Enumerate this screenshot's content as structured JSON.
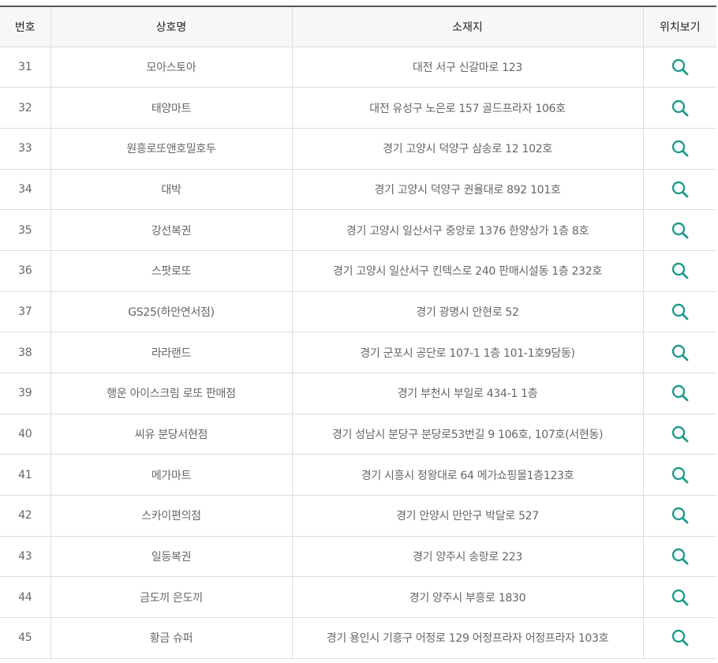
{
  "table": {
    "headers": [
      "번호",
      "상호명",
      "소재지",
      "위치보기"
    ],
    "rows": [
      {
        "no": "31",
        "name": "모아스토아",
        "address": "대전 서구 신갈마로 123",
        "icon": "search-icon"
      },
      {
        "no": "32",
        "name": "태양마트",
        "address": "대전 유성구 노은로 157 골드프라자 106호",
        "icon": "search-icon"
      },
      {
        "no": "33",
        "name": "원흥로또앤호밀호두",
        "address": "경기 고양시 덕양구 삼송로 12 102호",
        "icon": "search-icon"
      },
      {
        "no": "34",
        "name": "대박",
        "address": "경기 고양시 덕양구 권율대로 892 101호",
        "icon": "search-icon"
      },
      {
        "no": "35",
        "name": "강선복권",
        "address": "경기 고양시 일산서구 중앙로 1376 한양상가 1층 8호",
        "icon": "search-icon"
      },
      {
        "no": "36",
        "name": "스팟로또",
        "address": "경기 고양시 일산서구 킨텍스로 240 판매시설동 1층 232호",
        "icon": "search-icon"
      },
      {
        "no": "37",
        "name": "GS25(하안연서점)",
        "address": "경기 광명시 안현로 52",
        "icon": "search-icon"
      },
      {
        "no": "38",
        "name": "라라랜드",
        "address": "경기 군포시 공단로 107-1 1층 101-1호9당동)",
        "icon": "search-icon"
      },
      {
        "no": "39",
        "name": "행운 아이스크림 로또 판매점",
        "address": "경기 부천시 부일로 434-1 1층",
        "icon": "search-icon"
      },
      {
        "no": "40",
        "name": "씨유 분당서현점",
        "address": "경기 성남시 분당구 분당로53번길 9 106호, 107호(서현동)",
        "icon": "search-icon"
      },
      {
        "no": "41",
        "name": "메가마트",
        "address": "경기 시흥시 정왕대로 64 메가쇼핑몰1층123호",
        "icon": "search-icon"
      },
      {
        "no": "42",
        "name": "스카이편의점",
        "address": "경기 안양시 만안구 박달로 527",
        "icon": "search-icon"
      },
      {
        "no": "43",
        "name": "일등복권",
        "address": "경기 양주시 송랑로 223",
        "icon": "search-icon"
      },
      {
        "no": "44",
        "name": "금도끼 은도끼",
        "address": "경기 양주시 부흥로 1830",
        "icon": "search-icon"
      },
      {
        "no": "45",
        "name": "황금 슈퍼",
        "address": "경기 용인시 기흥구 어정로 129 어정프라자 어정프라자 103호",
        "icon": "search-icon"
      }
    ]
  },
  "colors": {
    "icon": "#1f9a8e",
    "header_bg": "#f7f7f7",
    "border": "#dddddd",
    "header_top_border": "#555555",
    "cell_text": "#666666",
    "header_text": "#222222"
  }
}
